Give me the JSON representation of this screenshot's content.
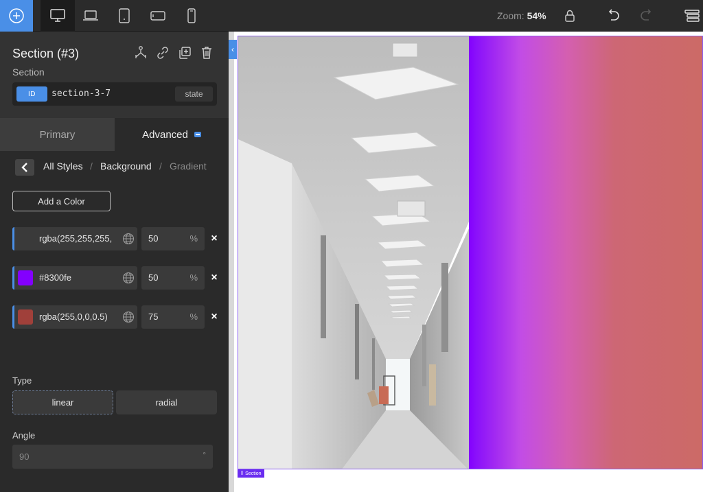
{
  "topbar": {
    "devices": [
      "desktop-icon",
      "laptop-icon",
      "tablet-icon",
      "tablet-landscape-icon",
      "phone-icon"
    ],
    "active_device": "desktop",
    "zoom_label": "Zoom:",
    "zoom_value": "54%"
  },
  "selection": {
    "title": "Section (#3)",
    "subtitle": "Section",
    "id_badge": "ID",
    "id_value": "section-3-7",
    "state_label": "state"
  },
  "tabs": {
    "primary": "Primary",
    "advanced": "Advanced"
  },
  "breadcrumb": {
    "items": [
      "All Styles",
      "Background",
      "Gradient"
    ],
    "separator": "/"
  },
  "gradient_editor": {
    "add_color_label": "Add a Color",
    "colors": [
      {
        "value": "rgba(255,255,255,",
        "swatch": "transparent",
        "percent": "50",
        "unit": "%"
      },
      {
        "value": "#8300fe",
        "swatch": "#8300fe",
        "percent": "50",
        "unit": "%"
      },
      {
        "value": "rgba(255,0,0,0.5)",
        "swatch": "#a0403a",
        "percent": "75",
        "unit": "%"
      }
    ],
    "remove_label": "×",
    "type_label": "Type",
    "type_options": [
      "linear",
      "radial"
    ],
    "type_selected": "linear",
    "angle_label": "Angle",
    "angle_placeholder": "90",
    "angle_unit": "°"
  },
  "canvas": {
    "section_tag": "Section",
    "colors": {
      "accent": "#4a8fe7",
      "frame": "#8a5cf0"
    }
  }
}
